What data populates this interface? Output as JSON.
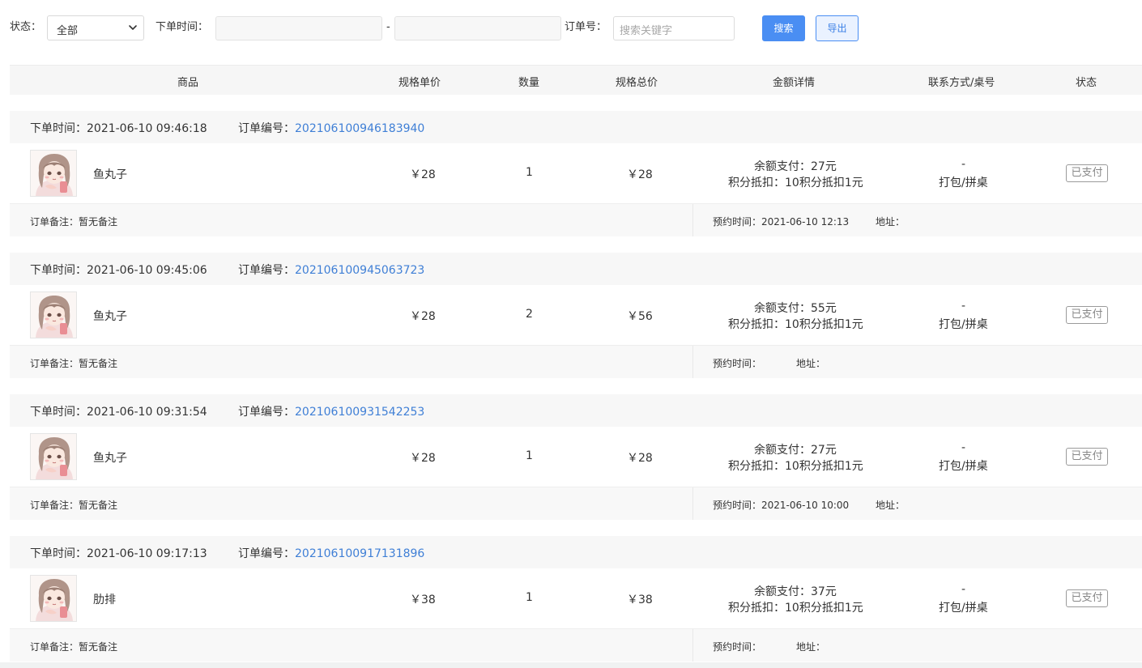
{
  "filter": {
    "status_label": "状态：",
    "status_value": "全部",
    "order_time_label": "下单时间：",
    "range_separator": "-",
    "order_no_label": "订单号：",
    "keyword_placeholder": "搜索关键字",
    "search_button": "搜索",
    "export_button": "导出"
  },
  "table_header": {
    "product": "商品",
    "unit_price": "规格单价",
    "quantity": "数量",
    "total_price": "规格总价",
    "amount_detail": "金额详情",
    "contact": "联系方式/桌号",
    "status": "状态"
  },
  "labels": {
    "order_time": "下单时间：",
    "order_no": "订单编号：",
    "remark": "订单备注：",
    "reserve_time": "预约时间：",
    "address": "地址："
  },
  "orders": [
    {
      "time": "2021-06-10 09:46:18",
      "order_no": "202106100946183940",
      "product": "鱼丸子",
      "unit_price": "￥28",
      "quantity": "1",
      "total_price": "￥28",
      "balance_pay": "余额支付：27元",
      "points_deduct": "积分抵扣：10积分抵扣1元",
      "contact": "-",
      "table": "打包/拼桌",
      "status": "已支付",
      "remark": "暂无备注",
      "reserve_time": "2021-06-10 12:13",
      "address": ""
    },
    {
      "time": "2021-06-10 09:45:06",
      "order_no": "202106100945063723",
      "product": "鱼丸子",
      "unit_price": "￥28",
      "quantity": "2",
      "total_price": "￥56",
      "balance_pay": "余额支付：55元",
      "points_deduct": "积分抵扣：10积分抵扣1元",
      "contact": "-",
      "table": "打包/拼桌",
      "status": "已支付",
      "remark": "暂无备注",
      "reserve_time": "",
      "address": ""
    },
    {
      "time": "2021-06-10 09:31:54",
      "order_no": "202106100931542253",
      "product": "鱼丸子",
      "unit_price": "￥28",
      "quantity": "1",
      "total_price": "￥28",
      "balance_pay": "余额支付：27元",
      "points_deduct": "积分抵扣：10积分抵扣1元",
      "contact": "-",
      "table": "打包/拼桌",
      "status": "已支付",
      "remark": "暂无备注",
      "reserve_time": "2021-06-10 10:00",
      "address": ""
    },
    {
      "time": "2021-06-10 09:17:13",
      "order_no": "202106100917131896",
      "product": "肋排",
      "unit_price": "￥38",
      "quantity": "1",
      "total_price": "￥38",
      "balance_pay": "余额支付：37元",
      "points_deduct": "积分抵扣：10积分抵扣1元",
      "contact": "-",
      "table": "打包/拼桌",
      "status": "已支付",
      "remark": "暂无备注",
      "reserve_time": "",
      "address": ""
    }
  ]
}
